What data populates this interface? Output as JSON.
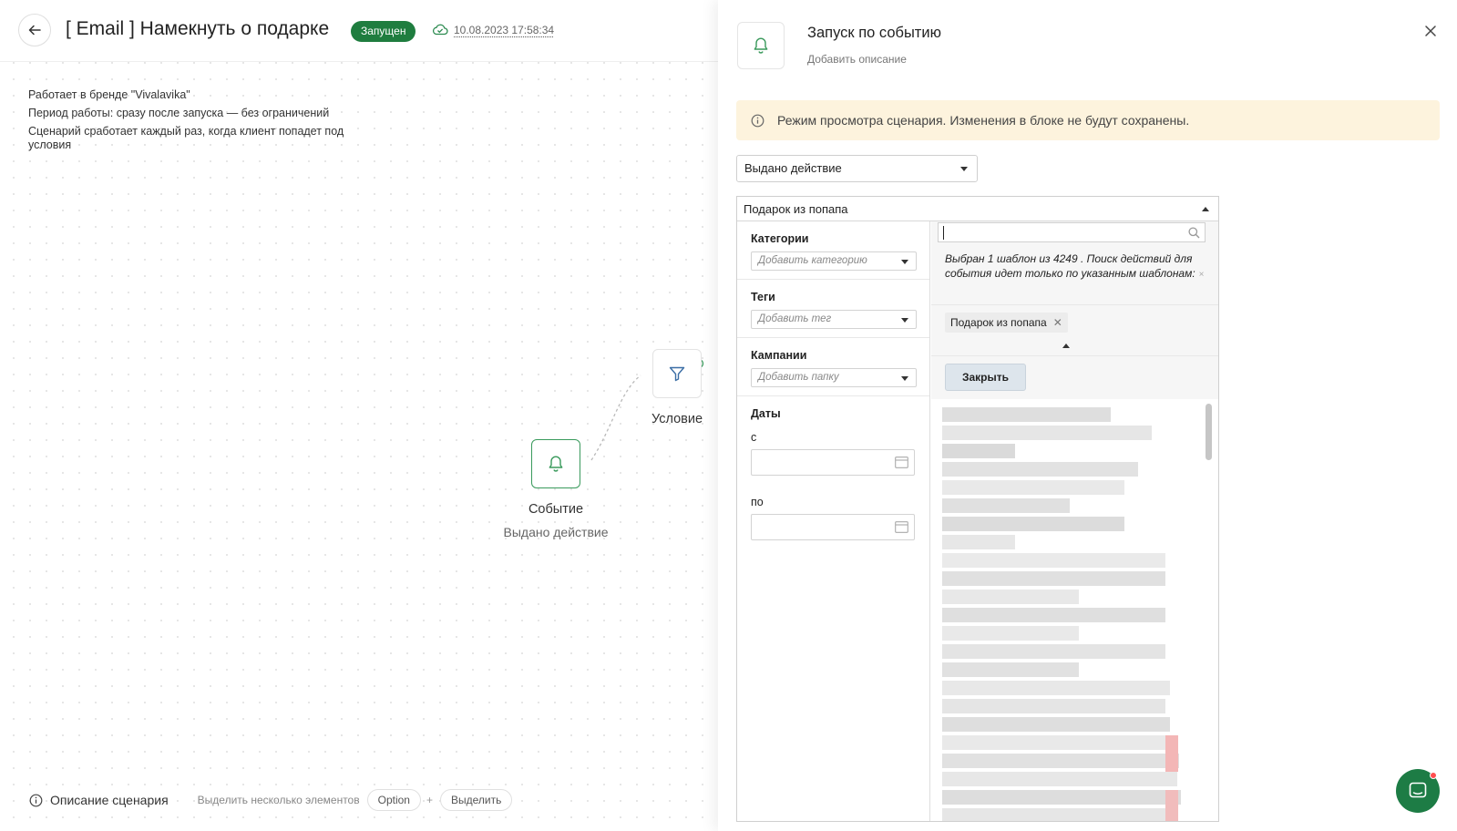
{
  "header": {
    "title": "[ Email ] Намекнуть о подарке",
    "status": "Запущен",
    "saved_time": "10.08.2023 17:58:34"
  },
  "scenario_info": {
    "line1": "Работает в бренде \"Vivalavika\"",
    "line2": "Период работы: сразу после запуска — без ограничений",
    "line3": "Сценарий сработает каждый раз, когда клиент попадет под условия"
  },
  "nodes": {
    "event_label": "Событие",
    "event_sub": "Выдано действие",
    "condition_label": "Условие"
  },
  "bottom": {
    "desc_link": "Описание сценария",
    "hint": "Выделить несколько элементов",
    "key": "Option",
    "plus": "+",
    "action": "Выделить"
  },
  "panel": {
    "title": "Запуск по событию",
    "add_desc": "Добавить описание",
    "warning": "Режим просмотра сценария. Изменения в блоке не будут сохранены.",
    "event_type": "Выдано действие",
    "action_value": "Подарок из попапа",
    "filters": {
      "categories_title": "Категории",
      "categories_placeholder": "Добавить категорию",
      "tags_title": "Теги",
      "tags_placeholder": "Добавить тег",
      "campaigns_title": "Кампании",
      "campaigns_placeholder": "Добавить папку",
      "dates_title": "Даты",
      "date_from": "с",
      "date_to": "по"
    },
    "templates": {
      "info": "Выбран 1 шаблон из 4249 . Поиск действий для события идет только по указанным шаблонам:",
      "info_x": "×",
      "chip": "Подарок из попапа",
      "chip_x": "✕",
      "close_button": "Закрыть"
    }
  },
  "icons": {
    "back": "arrow-left-icon",
    "cloud": "cloud-check-icon",
    "bell": "bell-icon",
    "filter": "filter-icon",
    "info": "info-icon",
    "close": "close-icon",
    "search": "search-icon",
    "calendar": "calendar-icon",
    "chat": "chat-icon"
  },
  "colors": {
    "brand_green": "#1f7d3f",
    "warning_bg": "#fdf3dd",
    "chat_green": "#1d7c45"
  }
}
